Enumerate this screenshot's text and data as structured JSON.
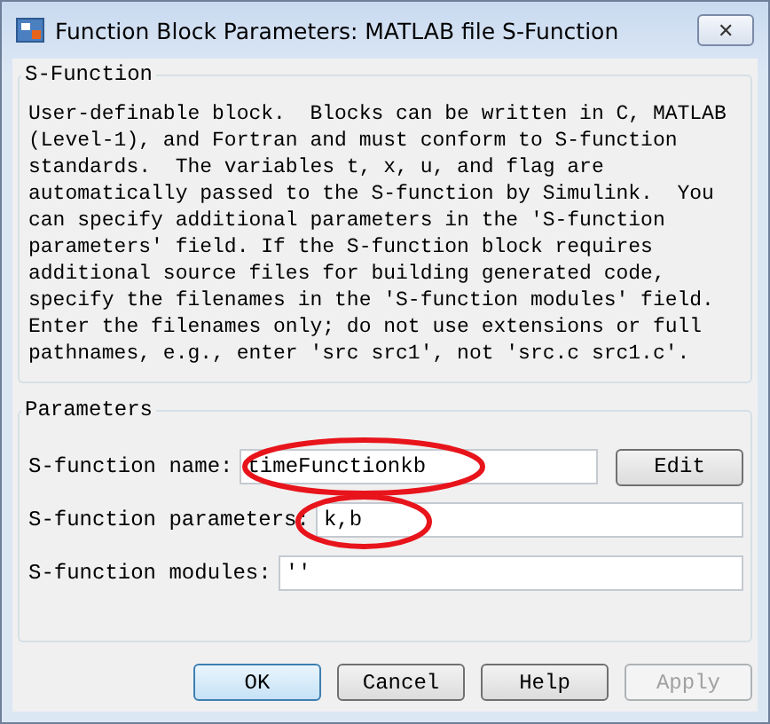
{
  "window": {
    "title": "Function Block Parameters: MATLAB file S-Function",
    "close": "✕"
  },
  "description": {
    "legend": "S-Function",
    "text": "User-definable block.  Blocks can be written in C, MATLAB\n(Level-1), and Fortran and must conform to S-function\nstandards.  The variables t, x, u, and flag are\nautomatically passed to the S-function by Simulink.  You\ncan specify additional parameters in the 'S-function\nparameters' field. If the S-function block requires\nadditional source files for building generated code,\nspecify the filenames in the 'S-function modules' field.\nEnter the filenames only; do not use extensions or full\npathnames, e.g., enter 'src src1', not 'src.c src1.c'."
  },
  "parameters": {
    "legend": "Parameters",
    "fields": [
      {
        "label": "S-function name:",
        "value": "timeFunctionkb",
        "button": "Edit",
        "circled": true
      },
      {
        "label": "S-function parameters:",
        "value": "k,b",
        "circled": true
      },
      {
        "label": "S-function modules:",
        "value": "''",
        "circled": false
      }
    ]
  },
  "buttons": [
    {
      "label": "OK",
      "default": true,
      "disabled": false
    },
    {
      "label": "Cancel",
      "default": false,
      "disabled": false
    },
    {
      "label": "Help",
      "default": false,
      "disabled": false
    },
    {
      "label": "Apply",
      "default": false,
      "disabled": true
    }
  ]
}
